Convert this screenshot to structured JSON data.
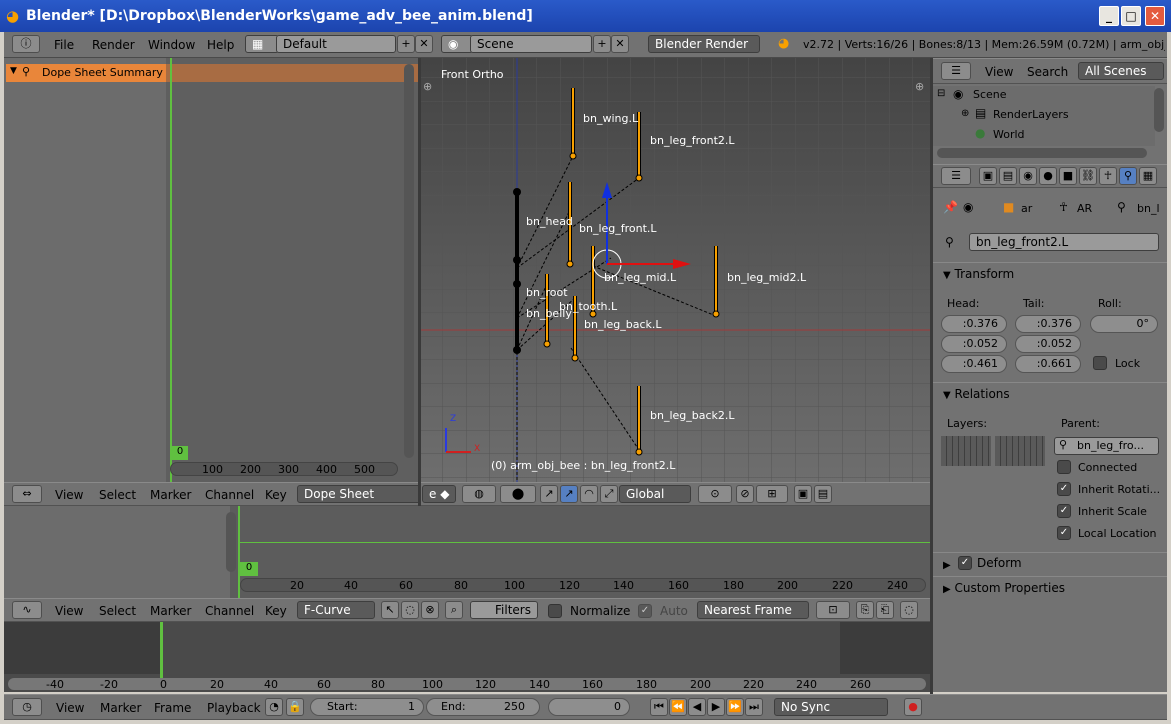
{
  "window": {
    "title": "Blender* [D:\\Dropbox\\BlenderWorks\\game_adv_bee_anim.blend]"
  },
  "topbar": {
    "menus": [
      "File",
      "Render",
      "Window",
      "Help"
    ],
    "screen": "Default",
    "scene": "Scene",
    "engine": "Blender Render",
    "stats": "v2.72 | Verts:16/26 | Bones:8/13 | Mem:26.59M (0.72M) | arm_obj_bee"
  },
  "dopesheet": {
    "summary": "Dope Sheet Summary",
    "frame": "0",
    "ticks": [
      "100",
      "200",
      "300",
      "400",
      "500"
    ],
    "menus": [
      "View",
      "Select",
      "Marker",
      "Channel",
      "Key"
    ],
    "mode": "Dope Sheet"
  },
  "viewport": {
    "view_label": "Front Ortho",
    "status": "(0) arm_obj_bee : bn_leg_front2.L",
    "pivot": "Global",
    "bones": [
      "bn_wing.L",
      "bn_leg_front2.L",
      "bn_head",
      "bn_leg_front.L",
      "bn_leg_mid.L",
      "bn_leg_mid2.L",
      "bn_root",
      "bn_tooth.L",
      "bn_belly",
      "bn_leg_back.L",
      "bn_leg_back2.L"
    ],
    "axis_z": "Z",
    "axis_x": "X"
  },
  "outliner": {
    "menus": [
      "View",
      "Search"
    ],
    "filter": "All Scenes",
    "tree": [
      "Scene",
      "RenderLayers",
      "World"
    ]
  },
  "properties": {
    "breadcrumb": [
      "ar",
      "AR",
      "bn_l"
    ],
    "bone_name": "bn_leg_front2.L",
    "transform": "Transform",
    "head_label": "Head:",
    "tail_label": "Tail:",
    "roll_label": "Roll:",
    "head": [
      ":0.376",
      ":0.052",
      ":0.461"
    ],
    "tail": [
      ":0.376",
      ":0.052",
      ":0.661"
    ],
    "roll": "0°",
    "lock": "Lock",
    "relations": "Relations",
    "layers_label": "Layers:",
    "parent_label": "Parent:",
    "parent": "bn_leg_fro...",
    "connected": "Connected",
    "inherit_rot": "Inherit Rotati...",
    "inherit_scale": "Inherit Scale",
    "local_loc": "Local Location",
    "deform": "Deform",
    "custom": "Custom Properties"
  },
  "timeline": {
    "frame": "0",
    "ticks": [
      "20",
      "40",
      "60",
      "80",
      "100",
      "120",
      "140",
      "160",
      "180",
      "200",
      "220",
      "240"
    ]
  },
  "graph": {
    "menus": [
      "View",
      "Select",
      "Marker",
      "Channel",
      "Key"
    ],
    "mode": "F-Curve",
    "filters": "Filters",
    "normalize": "Normalize",
    "auto": "Auto",
    "snap": "Nearest Frame",
    "ticks": [
      "-40",
      "-20",
      "0",
      "20",
      "40",
      "60",
      "80",
      "100",
      "120",
      "140",
      "160",
      "180",
      "200",
      "220",
      "240",
      "260"
    ]
  },
  "bottom": {
    "menus": [
      "View",
      "Marker",
      "Frame",
      "Playback"
    ],
    "start_label": "Start:",
    "start": "1",
    "end_label": "End:",
    "end": "250",
    "current": "0",
    "sync": "No Sync"
  }
}
